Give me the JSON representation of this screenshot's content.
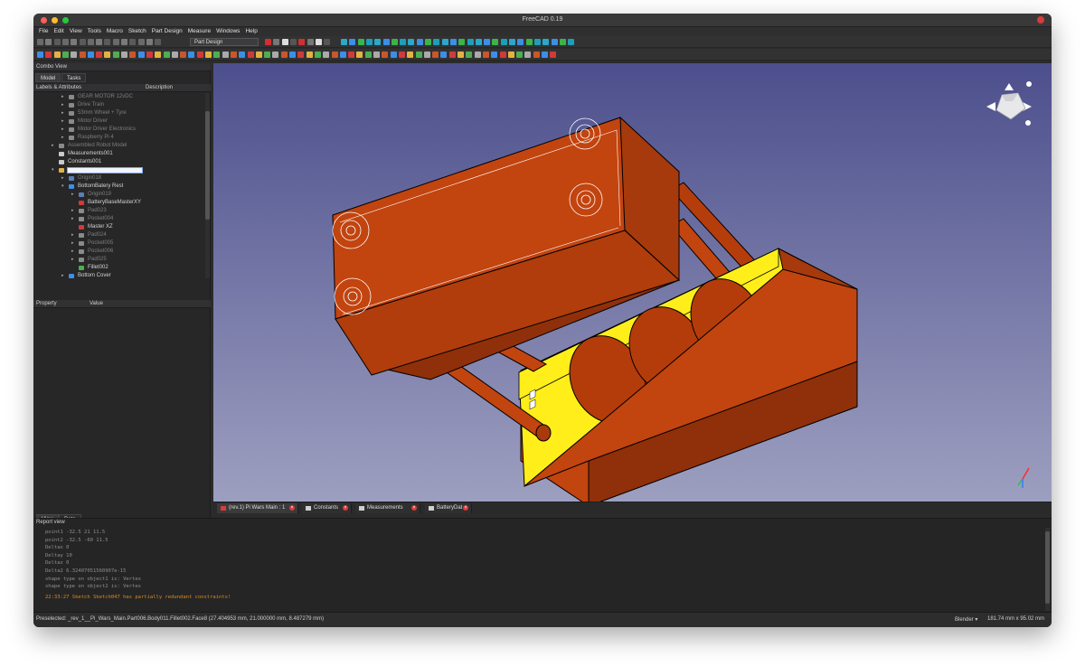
{
  "window": {
    "title": "FreeCAD 0.19"
  },
  "menu": [
    "File",
    "Edit",
    "View",
    "Tools",
    "Macro",
    "Sketch",
    "Part Design",
    "Measure",
    "Windows",
    "Help"
  ],
  "toolbar": {
    "workbench": "Part Design"
  },
  "combo": {
    "title": "Combo View",
    "tabs": [
      "Model",
      "Tasks"
    ],
    "col1": "Labels & Attributes",
    "col2": "Description"
  },
  "tree": [
    {
      "label": "GEAR MOTOR 12vDC",
      "indent": 3,
      "dim": true,
      "arrow": "▸",
      "icon": "#8a8a8a"
    },
    {
      "label": "Drive Train",
      "indent": 3,
      "dim": true,
      "arrow": "▸",
      "icon": "#8a8a8a"
    },
    {
      "label": "53mm Wheel + Tyre",
      "indent": 3,
      "dim": true,
      "arrow": "▸",
      "icon": "#8a8a8a"
    },
    {
      "label": "Motor Driver",
      "indent": 3,
      "dim": true,
      "arrow": "▸",
      "icon": "#8a8a8a"
    },
    {
      "label": "Motor Driver Electronics",
      "indent": 3,
      "dim": true,
      "arrow": "▸",
      "icon": "#8a8a8a"
    },
    {
      "label": "Raspberry Pi 4",
      "indent": 3,
      "dim": true,
      "arrow": "▸",
      "icon": "#8a8a8a"
    },
    {
      "label": "Assembled Robot Model",
      "indent": 2,
      "dim": true,
      "arrow": "▸",
      "icon": "#8a8a8a"
    },
    {
      "label": "Measurements001",
      "indent": 2,
      "dim": false,
      "arrow": "",
      "icon": "#c9c9c9"
    },
    {
      "label": "Constants001",
      "indent": 2,
      "dim": false,
      "arrow": "",
      "icon": "#c9c9c9"
    },
    {
      "label": "",
      "indent": 2,
      "dim": false,
      "arrow": "▾",
      "icon": "#e3b341",
      "selected": true
    },
    {
      "label": "Origin018",
      "indent": 3,
      "dim": true,
      "arrow": "▸",
      "icon": "#5a7fb8"
    },
    {
      "label": "BottomBatery Rest",
      "indent": 3,
      "dim": false,
      "arrow": "▾",
      "icon": "#3d8ee6"
    },
    {
      "label": "Origin019",
      "indent": 4,
      "dim": true,
      "arrow": "▸",
      "icon": "#5a7fb8"
    },
    {
      "label": "BatteryBaseMasterXY",
      "indent": 4,
      "dim": false,
      "arrow": "",
      "icon": "#d13a3a"
    },
    {
      "label": "Pad023",
      "indent": 4,
      "dim": true,
      "arrow": "▸",
      "icon": "#8a8a8a"
    },
    {
      "label": "Pocket004",
      "indent": 4,
      "dim": true,
      "arrow": "▸",
      "icon": "#8a8a8a"
    },
    {
      "label": "Master XZ",
      "indent": 4,
      "dim": false,
      "arrow": "",
      "icon": "#d13a3a"
    },
    {
      "label": "Pad024",
      "indent": 4,
      "dim": true,
      "arrow": "▸",
      "icon": "#8a8a8a"
    },
    {
      "label": "Pocket005",
      "indent": 4,
      "dim": true,
      "arrow": "▸",
      "icon": "#8a8a8a"
    },
    {
      "label": "Pocket006",
      "indent": 4,
      "dim": true,
      "arrow": "▸",
      "icon": "#8a8a8a"
    },
    {
      "label": "Pad025",
      "indent": 4,
      "dim": true,
      "arrow": "▸",
      "icon": "#8a8a8a"
    },
    {
      "label": "Fillet002",
      "indent": 4,
      "dim": false,
      "arrow": "",
      "icon": "#4caf50"
    },
    {
      "label": "Bottom Cover",
      "indent": 3,
      "dim": false,
      "arrow": "▸",
      "icon": "#3d8ee6"
    }
  ],
  "props": {
    "col1": "Property",
    "col2": "Value",
    "tabs": [
      "View",
      "Data"
    ]
  },
  "doctabs": [
    "(rev.1) Pi Wars Main : 1",
    "Constants",
    "Measurements",
    "BatteryDat"
  ],
  "report": {
    "title": "Report view",
    "lines": [
      "point1 -32.5  21  11.5",
      "point2 -32.5  -60  11.5",
      "Deltax 0",
      "Deltay 10",
      "Deltaz 0",
      "Delta2 6.32407051560907e-15",
      "shape type on object1 is: Vertex",
      "shape type on object2 is: Vertex"
    ],
    "warning": "22:33:27  Sketch Sketch047 has partially redundant constraints!"
  },
  "status": {
    "preselected": "Preselected: _rev_1__Pi_Wars_Main.Part006.Body011.Fillet002.Face8 (27.404953 mm, 21.000000 mm, 8.487279 mm)",
    "nav": "Blender ▾",
    "dims": "181.74 mm x 95.02 mm"
  },
  "colors": {
    "body": "#c2440f",
    "body_dark": "#8f300a",
    "highlight": "#ffee1a",
    "bg_top": "#4c4f8c",
    "bg_bottom": "#9d9fc0"
  }
}
